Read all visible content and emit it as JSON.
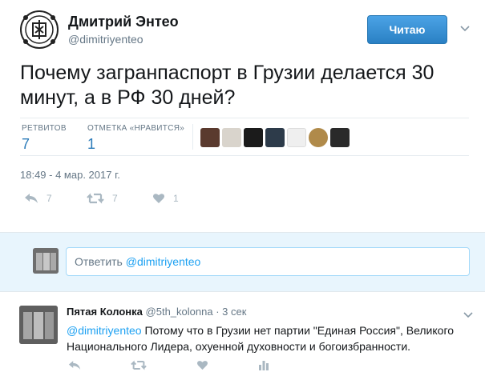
{
  "tweet": {
    "author_name": "Дмитрий Энтео",
    "author_handle": "@dimitriyenteo",
    "follow_label": "Читаю",
    "text": "Почему загранпаспорт в Грузии делается 30 минут, а в РФ 30 дней?",
    "retweets_label": "РЕТВИТОВ",
    "retweets_count": "7",
    "likes_label": "ОТМЕТКА «НРАВИТСЯ»",
    "likes_count": "1",
    "timestamp": "18:49 - 4 мар. 2017 г.",
    "actions": {
      "reply_count": "7",
      "retweet_count": "7",
      "like_count": "1"
    },
    "likers": [
      {
        "icon": "liker-avatar-1",
        "color": "#5a3a2e"
      },
      {
        "icon": "liker-avatar-2",
        "color": "#d9d4cc"
      },
      {
        "icon": "liker-avatar-3",
        "color": "#1b1b1b"
      },
      {
        "icon": "liker-avatar-4",
        "color": "#2d3b4a"
      },
      {
        "icon": "liker-avatar-5",
        "color": "#efefef"
      },
      {
        "icon": "liker-avatar-6",
        "color": "#b08a4a"
      },
      {
        "icon": "liker-avatar-7",
        "color": "#2a2a2a"
      }
    ]
  },
  "reply_box": {
    "prefix": "Ответить ",
    "handle": "@dimitriyenteo"
  },
  "reply_tweet": {
    "author_name": "Пятая Колонка",
    "author_handle": "@5th_kolonna",
    "dot": "·",
    "time": "3 сек",
    "mention": "@dimitriyenteo",
    "text": " Потому что в Грузии нет партии \"Единая Россия\", Великого Национального Лидера, охуенной духовности и богоизбранности."
  },
  "colors": {
    "accent": "#1da1f2",
    "follow_button": "#2b7bb9",
    "muted": "#657786",
    "icon": "#aab8c2",
    "reply_bg": "#e8f5fd"
  }
}
